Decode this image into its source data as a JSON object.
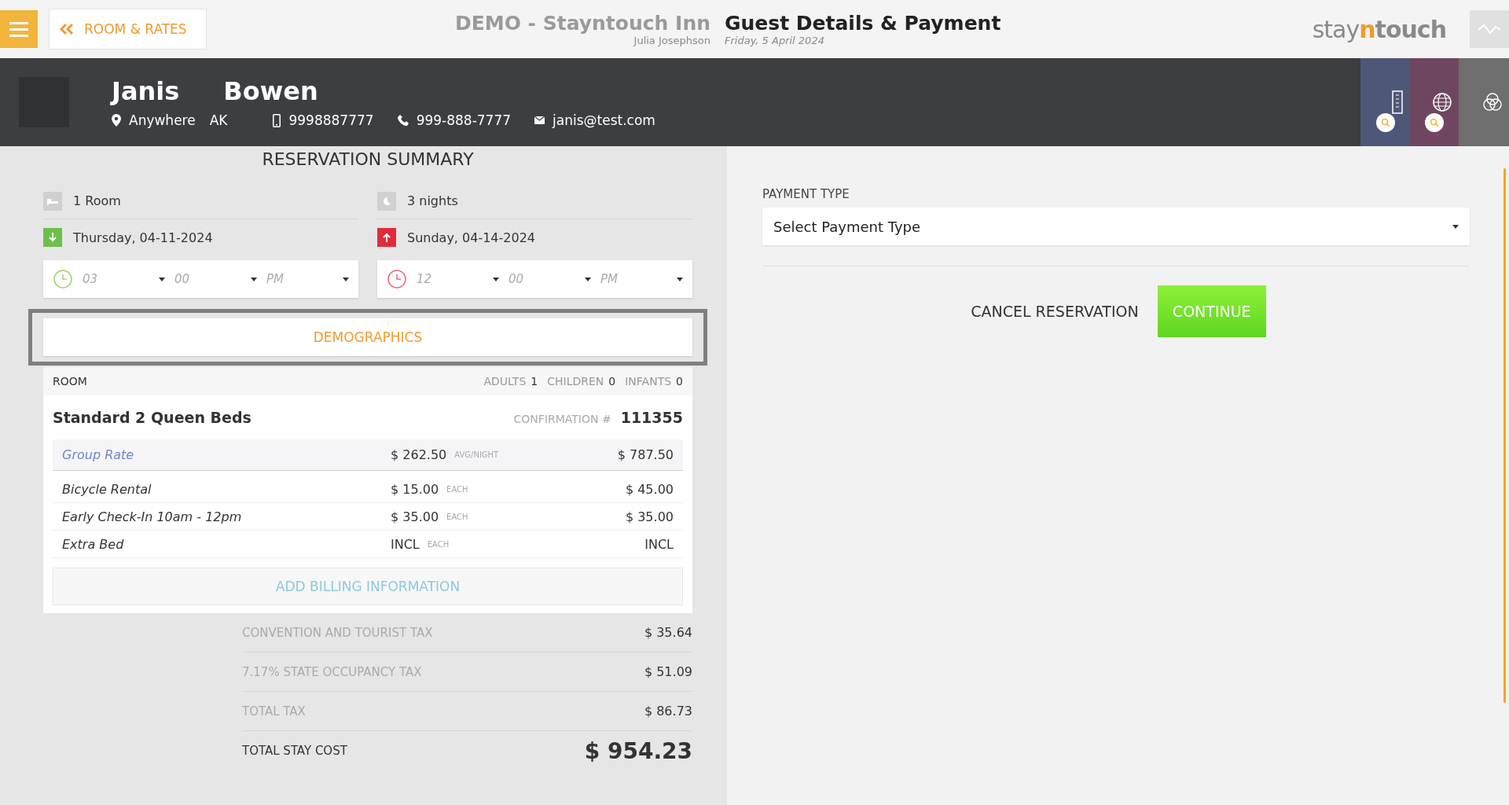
{
  "top_bar": {
    "back_button": "ROOM & RATES",
    "hotel": "DEMO - Stayntouch Inn",
    "user": "Julia Josephson",
    "page_title": "Guest Details & Payment",
    "date": "Friday, 5 April 2024",
    "logo": [
      "stay",
      "n",
      "touch"
    ]
  },
  "guest": {
    "first_name": "Janis",
    "last_name": "Bowen",
    "city": "Anywhere",
    "state": "AK",
    "mobile": "9998887777",
    "phone": "999-888-7777",
    "email": "janis@test.com"
  },
  "summary": {
    "title": "RESERVATION SUMMARY",
    "rooms": "1 Room",
    "nights": "3 nights",
    "arrival": {
      "date": "Thursday, 04-11-2024",
      "hour": "03",
      "minute": "00",
      "ampm": "PM"
    },
    "departure": {
      "date": "Sunday, 04-14-2024",
      "hour": "12",
      "minute": "00",
      "ampm": "PM"
    },
    "demographics_button": "DEMOGRAPHICS",
    "room": {
      "label": "ROOM",
      "occupancy": [
        {
          "label": "ADULTS",
          "value": "1"
        },
        {
          "label": "CHILDREN",
          "value": "0"
        },
        {
          "label": "INFANTS",
          "value": "0"
        }
      ],
      "name": "Standard 2 Queen Beds",
      "confirmation_label": "CONFIRMATION #",
      "confirmation": "111355",
      "rate": {
        "name": "Group Rate",
        "price": "$ 262.50",
        "unit": "AVG/NIGHT",
        "total": "$ 787.50"
      },
      "addons": [
        {
          "name": "Bicycle Rental",
          "price": "$ 15.00",
          "unit": "EACH",
          "total": "$ 45.00"
        },
        {
          "name": "Early Check-In 10am - 12pm",
          "price": "$ 35.00",
          "unit": "EACH",
          "total": "$ 35.00"
        },
        {
          "name": "Extra Bed",
          "price": "INCL",
          "unit": "EACH",
          "total": "INCL"
        }
      ],
      "billing_button": "ADD BILLING INFORMATION"
    },
    "taxes": [
      {
        "label": "CONVENTION AND TOURIST TAX",
        "amount": "$ 35.64"
      },
      {
        "label": "7.17% STATE OCCUPANCY TAX",
        "amount": "$ 51.09"
      },
      {
        "label": "TOTAL TAX",
        "amount": "$ 86.73"
      }
    ],
    "total": {
      "label": "TOTAL STAY COST",
      "amount": "$ 954.23"
    }
  },
  "payment": {
    "label": "PAYMENT TYPE",
    "placeholder": "Select Payment Type",
    "cancel_button": "CANCEL RESERVATION",
    "continue_button": "CONTINUE"
  }
}
